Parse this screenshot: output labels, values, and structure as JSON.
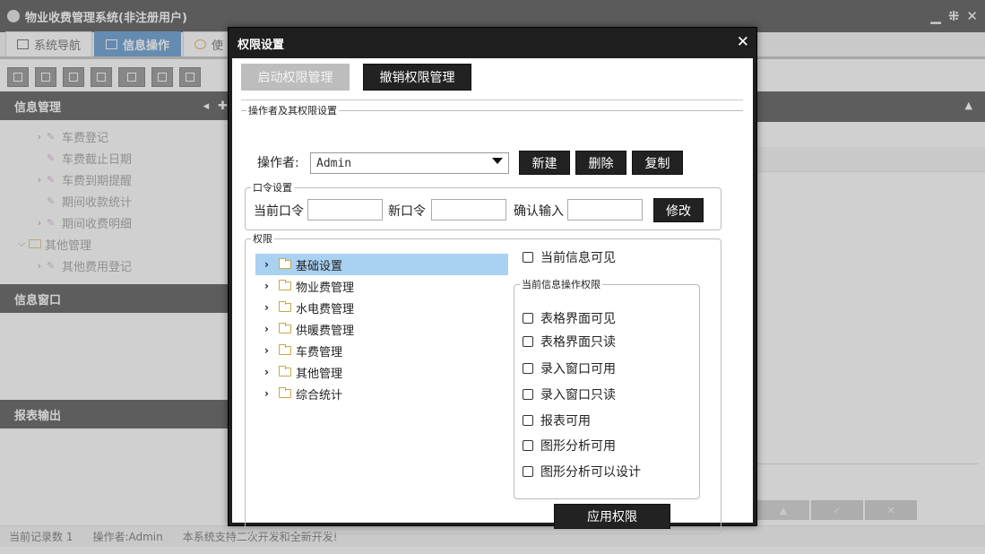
{
  "app": {
    "title": "物业收费管理系统(非注册用户)",
    "tabs": [
      {
        "label": "系统导航"
      },
      {
        "label": "信息操作"
      },
      {
        "label": "使"
      }
    ],
    "panels": {
      "info_manage": "信息管理",
      "info_window": "信息窗口",
      "report_output": "报表输出"
    },
    "tree": [
      {
        "label": "车费登记",
        "level": 2,
        "expandable": true
      },
      {
        "label": "车费截止日期",
        "level": 2,
        "expandable": false
      },
      {
        "label": "车费到期提醒",
        "level": 2,
        "expandable": true
      },
      {
        "label": "期间收款统计",
        "level": 2,
        "expandable": false
      },
      {
        "label": "期间收费明细",
        "level": 2,
        "expandable": true
      },
      {
        "label": "其他管理",
        "level": 1,
        "expandable": true
      },
      {
        "label": "其他费用登记",
        "level": 2,
        "expandable": true
      }
    ],
    "status": {
      "record_count": "当前记录数 1",
      "operator": "操作者:Admin",
      "note": "本系统支持二次开发和全新开发!"
    }
  },
  "dialog": {
    "title": "权限设置",
    "close_glyph": "✕",
    "enable_button": "启动权限管理",
    "revoke_button": "撤销权限管理",
    "operator_group": {
      "legend": "操作者及其权限设置",
      "operator_label": "操作者:",
      "operator_value": "Admin",
      "new_button": "新建",
      "delete_button": "删除",
      "copy_button": "复制"
    },
    "password_group": {
      "legend": "口令设置",
      "current_label": "当前口令",
      "new_label": "新口令",
      "confirm_label": "确认输入",
      "modify_button": "修改"
    },
    "permission_group": {
      "legend": "权限",
      "tree": [
        {
          "label": "基础设置",
          "selected": true
        },
        {
          "label": "物业费管理",
          "selected": false
        },
        {
          "label": "水电费管理",
          "selected": false
        },
        {
          "label": "供暖费管理",
          "selected": false
        },
        {
          "label": "车费管理",
          "selected": false
        },
        {
          "label": "其他管理",
          "selected": false
        },
        {
          "label": "综合统计",
          "selected": false
        }
      ],
      "visible_checkbox": "当前信息可见",
      "ops_legend": "当前信息操作权限",
      "ops": [
        "表格界面可见",
        "表格界面只读",
        "录入窗口可用",
        "录入窗口只读",
        "报表可用",
        "图形分析可用",
        "图形分析可以设计"
      ],
      "apply_button": "应用权限"
    }
  },
  "colors": {
    "dark_header": "#2f2f2f",
    "accent_tab": "#3c82c6",
    "selected_row": "#a8d1f2"
  }
}
